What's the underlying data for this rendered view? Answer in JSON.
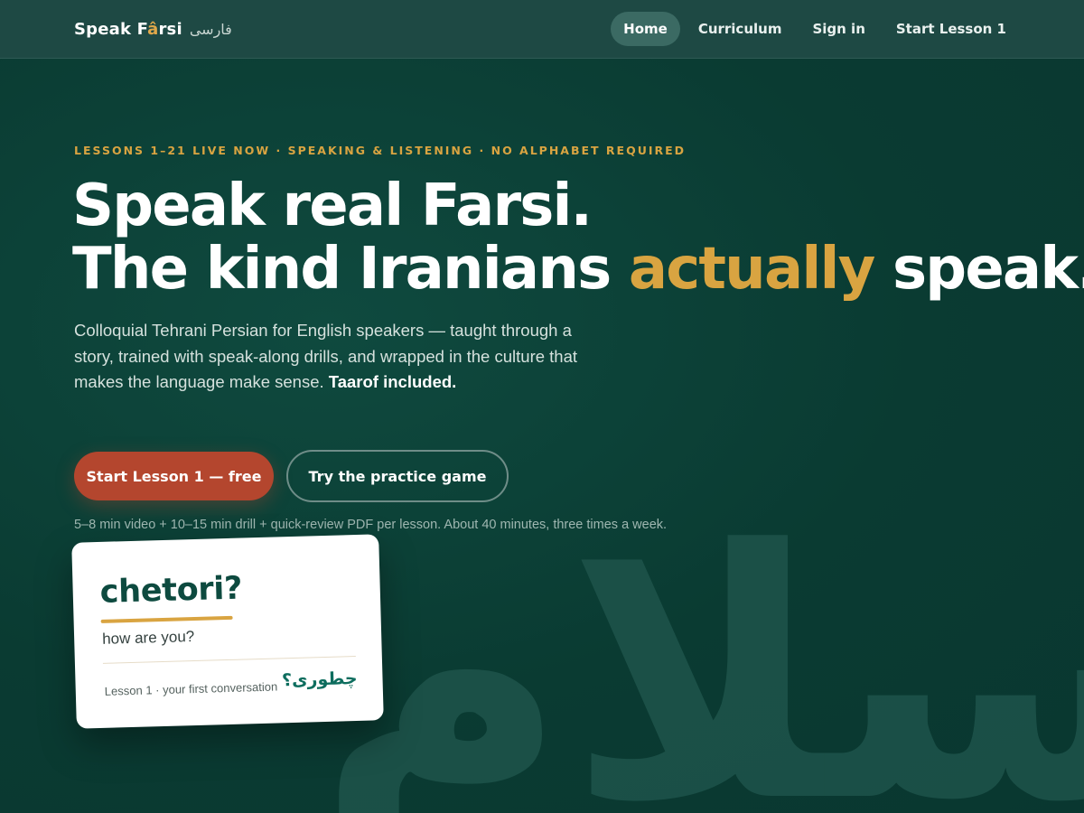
{
  "header": {
    "brand_prefix": "Speak F",
    "brand_accent": "â",
    "brand_suffix": "rsi",
    "brand_farsi": "فارسی",
    "nav": [
      {
        "label": "Home",
        "active": true
      },
      {
        "label": "Curriculum",
        "active": false
      },
      {
        "label": "Sign in",
        "active": false
      },
      {
        "label": "Start Lesson 1",
        "active": false
      }
    ]
  },
  "hero": {
    "eyebrow": "LESSONS 1–21 LIVE NOW · SPEAKING & LISTENING · NO ALPHABET REQUIRED",
    "headline_line1": "Speak real Farsi.",
    "headline_line2_before": "The kind Iranians ",
    "headline_line2_accent": "actually",
    "headline_line2_after": " speak.",
    "lede_text": "Colloquial Tehrani Persian for English speakers — taught through a story, trained with speak-along drills, and wrapped in the culture that makes the language make sense. ",
    "lede_strong": "Taarof included.",
    "primary_cta": "Start Lesson 1 — free",
    "secondary_cta": "Try the practice game",
    "note": "5–8 min video + 10–15 min drill + quick-review PDF per lesson. About 40 minutes, three times a week."
  },
  "card": {
    "word": "chetori?",
    "meaning": "how are you?",
    "lesson": "Lesson 1 · your first conversation",
    "farsi": "چطوری؟"
  },
  "watermark": "سلام",
  "colors": {
    "background": "#0b3d34",
    "header": "#1e4944",
    "accent_gold": "#d9a441",
    "primary_button": "#b4462e"
  }
}
